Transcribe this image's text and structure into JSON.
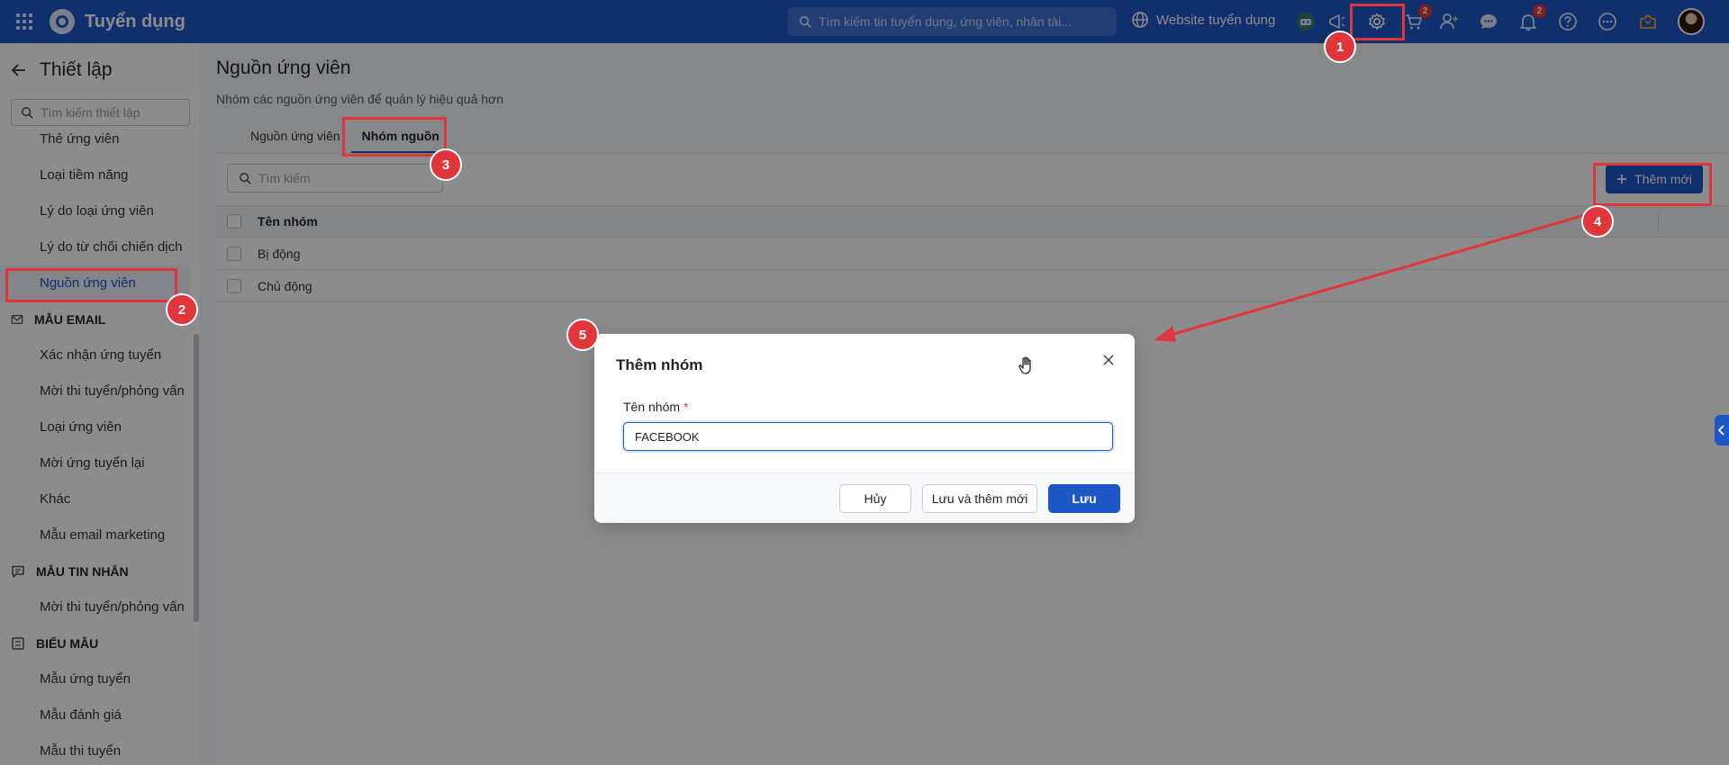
{
  "topbar": {
    "app_title": "Tuyển dụng",
    "search_placeholder": "Tìm kiếm tin tuyển dụng, ứng viên, nhân tài...",
    "website_link": "Website tuyển dụng",
    "cart_badge": "2",
    "notification_badge": "2",
    "icons": [
      "apps-grid-icon",
      "app-logo-icon",
      "globe-icon",
      "robot-icon",
      "megaphone-icon",
      "gear-icon",
      "cart-icon",
      "add-user-icon",
      "chat-icon",
      "bell-icon",
      "help-icon",
      "more-icon",
      "inbox-icon",
      "avatar"
    ]
  },
  "sidebar": {
    "title": "Thiết lập",
    "search_placeholder": "Tìm kiếm thiết lập",
    "items_top": [
      {
        "label": "Thẻ ứng viên"
      },
      {
        "label": "Loại tiềm năng"
      },
      {
        "label": "Lý do loại ứng viên"
      },
      {
        "label": "Lý do từ chối chiến dịch"
      },
      {
        "label": "Nguồn ứng viên",
        "active": true
      }
    ],
    "section_email": {
      "label": "MẪU EMAIL",
      "items": [
        {
          "label": "Xác nhận ứng tuyển"
        },
        {
          "label": "Mời thi tuyển/phỏng vấn"
        },
        {
          "label": "Loại ứng viên"
        },
        {
          "label": "Mời ứng tuyển lại"
        },
        {
          "label": "Khác"
        },
        {
          "label": "Mẫu email marketing"
        }
      ]
    },
    "section_message": {
      "label": "MẪU TIN NHẮN",
      "items": [
        {
          "label": "Mời thi tuyển/phỏng vấn"
        }
      ]
    },
    "section_form": {
      "label": "BIỂU MẪU",
      "items": [
        {
          "label": "Mẫu ứng tuyển"
        },
        {
          "label": "Mẫu đánh giá"
        },
        {
          "label": "Mẫu thi tuyển"
        }
      ]
    }
  },
  "main": {
    "title": "Nguồn ứng viên",
    "subtitle": "Nhóm các nguồn ứng viên để quản lý hiệu quả hơn",
    "tabs": [
      {
        "label": "Nguồn ứng viên",
        "active": false
      },
      {
        "label": "Nhóm nguồn",
        "active": true
      }
    ],
    "search_placeholder": "Tìm kiếm",
    "add_button": "Thêm mới",
    "table": {
      "column": "Tên nhóm",
      "rows": [
        "Bị động",
        "Chủ động"
      ]
    }
  },
  "dialog": {
    "title": "Thêm nhóm",
    "field_label": "Tên nhóm",
    "required_mark": "*",
    "field_value": "FACEBOOK",
    "cancel_button": "Hủy",
    "save_and_new_button": "Lưu và thêm mới",
    "save_button": "Lưu"
  },
  "annotations": {
    "markers": [
      "1",
      "2",
      "3",
      "4",
      "5"
    ],
    "color": "#e0353a"
  },
  "colors": {
    "brand_blue": "#1e56c6",
    "annotation_red": "#e0353a"
  }
}
